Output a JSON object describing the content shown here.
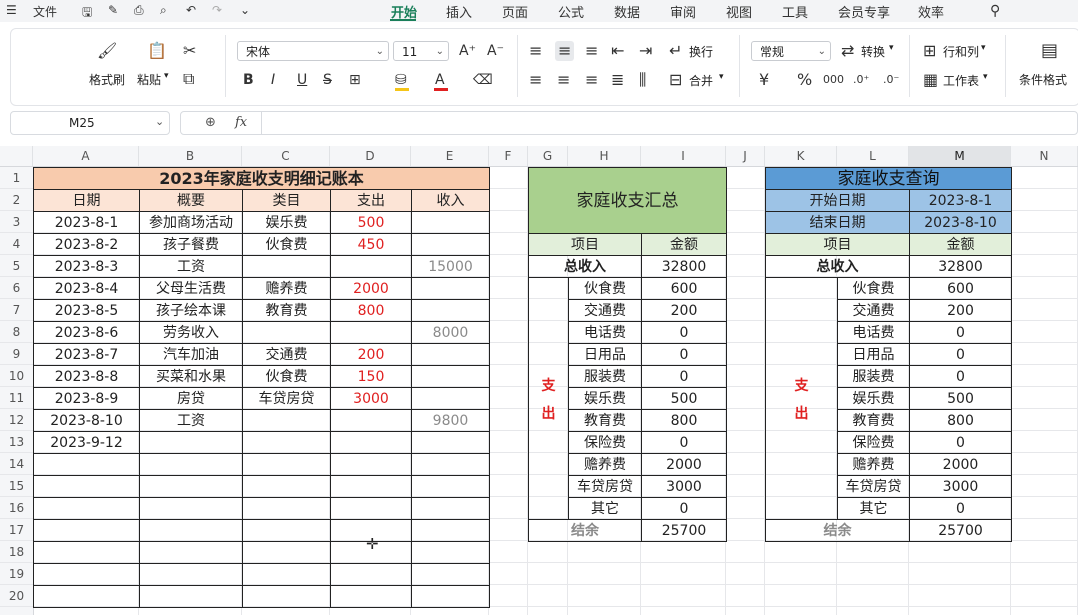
{
  "titlebar": {
    "file_menu": "文件",
    "tabs": [
      "开始",
      "插入",
      "页面",
      "公式",
      "数据",
      "审阅",
      "视图",
      "工具",
      "会员专享",
      "效率"
    ],
    "active_tab": "开始"
  },
  "ribbon": {
    "format_painter": "格式刷",
    "paste": "粘贴",
    "font_name": "宋体",
    "font_size": "11",
    "wrap": "换行",
    "merge": "合并",
    "number_format": "常规",
    "convert": "转换",
    "row_col": "行和列",
    "worksheet": "工作表",
    "cond_format": "条件格式",
    "font_color": "#e02020",
    "fill_color": "#f5c518"
  },
  "formula": {
    "name_box": "M25",
    "fx": "fx",
    "content": ""
  },
  "columns": [
    "A",
    "B",
    "C",
    "D",
    "E",
    "F",
    "G",
    "H",
    "I",
    "J",
    "K",
    "L",
    "M",
    "N"
  ],
  "rows": [
    "1",
    "2",
    "3",
    "4",
    "5",
    "6",
    "7",
    "8",
    "9",
    "10",
    "11",
    "12",
    "13",
    "14",
    "15",
    "16",
    "17",
    "18",
    "19",
    "20"
  ],
  "ledger": {
    "title": "2023年家庭收支明细记账本",
    "headers": [
      "日期",
      "概要",
      "类目",
      "支出",
      "收入"
    ],
    "rows": [
      [
        "2023-8-1",
        "参加商场活动",
        "娱乐费",
        "500",
        ""
      ],
      [
        "2023-8-2",
        "孩子餐费",
        "伙食费",
        "450",
        ""
      ],
      [
        "2023-8-3",
        "工资",
        "",
        "",
        "15000"
      ],
      [
        "2023-8-4",
        "父母生活费",
        "赡养费",
        "2000",
        ""
      ],
      [
        "2023-8-5",
        "孩子绘本课",
        "教育费",
        "800",
        ""
      ],
      [
        "2023-8-6",
        "劳务收入",
        "",
        "",
        "8000"
      ],
      [
        "2023-8-7",
        "汽车加油",
        "交通费",
        "200",
        ""
      ],
      [
        "2023-8-8",
        "买菜和水果",
        "伙食费",
        "150",
        ""
      ],
      [
        "2023-8-9",
        "房贷",
        "车贷房贷",
        "3000",
        ""
      ],
      [
        "2023-8-10",
        "工资",
        "",
        "",
        "9800"
      ],
      [
        "2023-9-12",
        "",
        "",
        "",
        ""
      ]
    ]
  },
  "summary": {
    "title": "家庭收支汇总",
    "col_item": "项目",
    "col_amount": "金额",
    "total_income_label": "总收入",
    "total_income": "32800",
    "expense_label": "支出",
    "items": [
      [
        "伙食费",
        "600"
      ],
      [
        "交通费",
        "200"
      ],
      [
        "电话费",
        "0"
      ],
      [
        "日用品",
        "0"
      ],
      [
        "服装费",
        "0"
      ],
      [
        "娱乐费",
        "500"
      ],
      [
        "教育费",
        "800"
      ],
      [
        "保险费",
        "0"
      ],
      [
        "赡养费",
        "2000"
      ],
      [
        "车贷房贷",
        "3000"
      ],
      [
        "其它",
        "0"
      ]
    ],
    "balance_label": "结余",
    "balance": "25700"
  },
  "query": {
    "title": "家庭收支查询",
    "start_label": "开始日期",
    "start_value": "2023-8-1",
    "end_label": "结束日期",
    "end_value": "2023-8-10",
    "col_item": "项目",
    "col_amount": "金额",
    "total_income_label": "总收入",
    "total_income": "32800",
    "expense_label": "支出",
    "items": [
      [
        "伙食费",
        "600"
      ],
      [
        "交通费",
        "200"
      ],
      [
        "电话费",
        "0"
      ],
      [
        "日用品",
        "0"
      ],
      [
        "服装费",
        "0"
      ],
      [
        "娱乐费",
        "500"
      ],
      [
        "教育费",
        "800"
      ],
      [
        "保险费",
        "0"
      ],
      [
        "赡养费",
        "2000"
      ],
      [
        "车贷房贷",
        "3000"
      ],
      [
        "其它",
        "0"
      ]
    ],
    "balance_label": "结余",
    "balance": "25700"
  },
  "colors": {
    "ledger_title_bg": "#f8cbad",
    "ledger_header_bg": "#fce4d6",
    "summary_title_bg": "#a9d08e",
    "summary_header_bg": "#e2efda",
    "query_title_bg": "#5b9bd5",
    "query_date_bg": "#9dc3e6",
    "query_header_bg": "#e2efda",
    "accent": "#1a7f5a"
  }
}
